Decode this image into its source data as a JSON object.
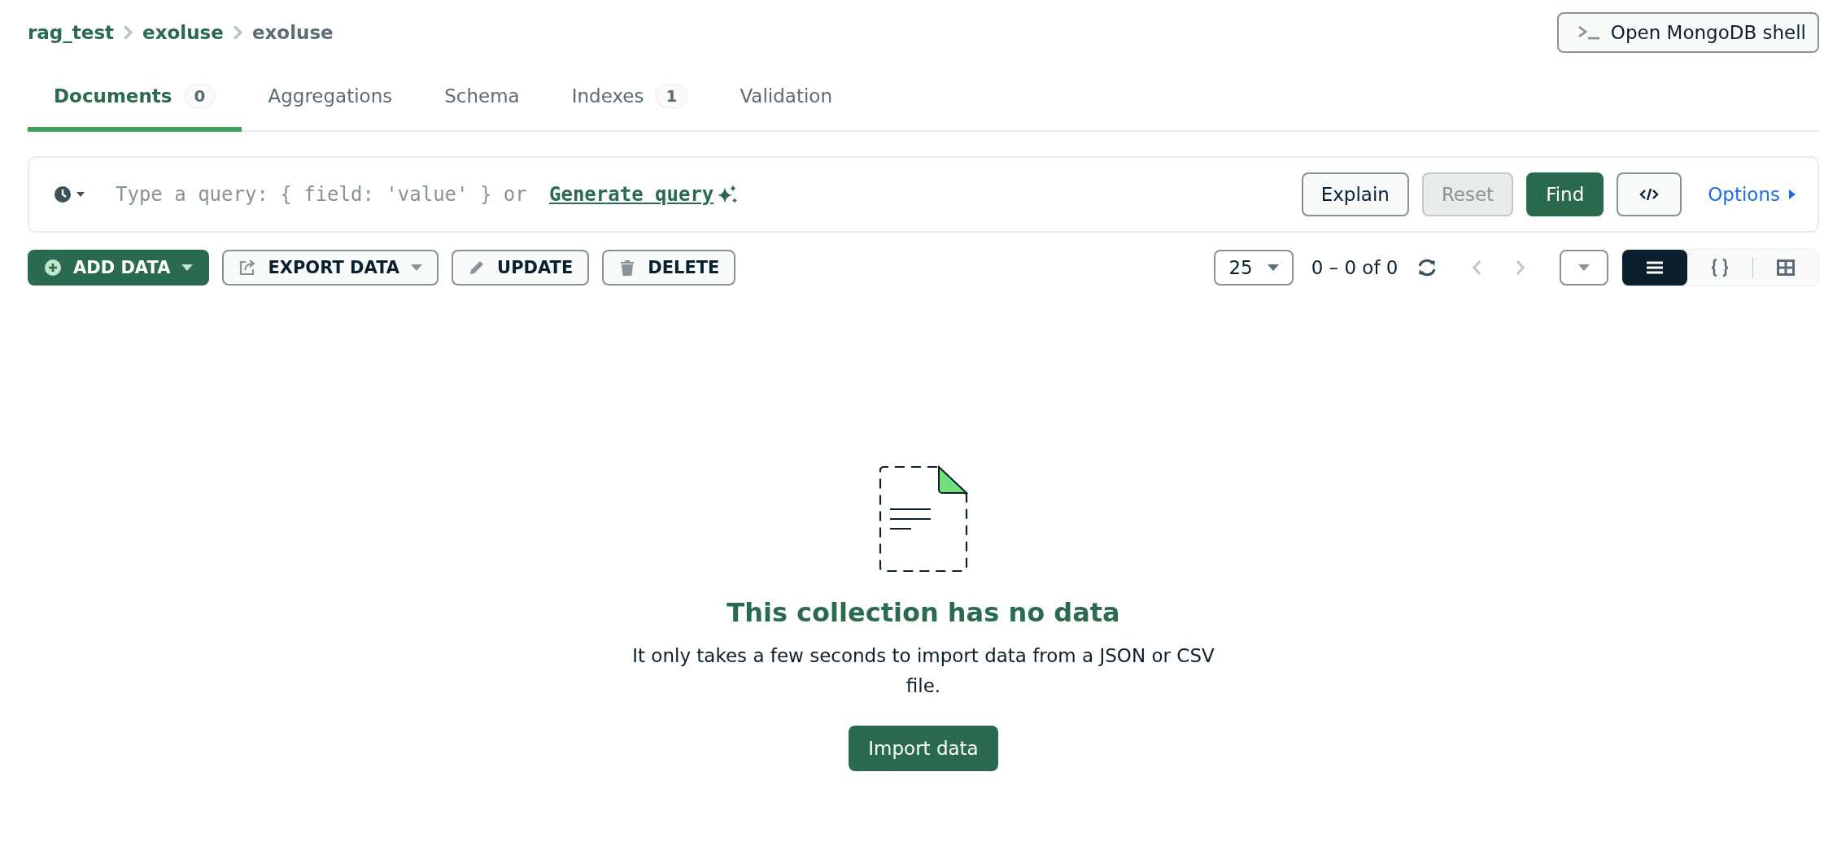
{
  "breadcrumb": [
    {
      "label": "rag_test",
      "kind": "link"
    },
    {
      "label": "exoluse",
      "kind": "link"
    },
    {
      "label": "exoluse",
      "kind": "current"
    }
  ],
  "shell_button": {
    "label": "Open MongoDB shell"
  },
  "tabs": [
    {
      "label": "Documents",
      "count": "0",
      "selected": true
    },
    {
      "label": "Aggregations",
      "selected": false
    },
    {
      "label": "Schema",
      "selected": false
    },
    {
      "label": "Indexes",
      "count": "1",
      "selected": false
    },
    {
      "label": "Validation",
      "selected": false
    }
  ],
  "query_bar": {
    "placeholder": "Type a query: { field: 'value' } or",
    "generate_link": "Generate query",
    "buttons": [
      {
        "label": "Explain",
        "kind": "outline",
        "disabled": false
      },
      {
        "label": "Reset",
        "kind": "outline",
        "disabled": true
      },
      {
        "label": "Find",
        "kind": "primary",
        "disabled": false
      },
      {
        "kind": "code",
        "disabled": false
      }
    ],
    "options_link": "Options"
  },
  "toolbar": {
    "actions": [
      {
        "label": "ADD DATA",
        "kind": "add",
        "dropdown": true
      },
      {
        "label": "EXPORT DATA",
        "kind": "export",
        "dropdown": true
      },
      {
        "label": "UPDATE",
        "kind": "update",
        "dropdown": false
      },
      {
        "label": "DELETE",
        "kind": "delete",
        "dropdown": false
      }
    ],
    "page_size": "25",
    "range": "0 – 0 of 0",
    "view_modes": [
      {
        "kind": "list",
        "selected": true
      },
      {
        "kind": "json",
        "selected": false
      },
      {
        "kind": "table",
        "selected": false
      }
    ]
  },
  "empty_state": {
    "title": "This collection has no data",
    "message": "It only takes a few seconds to import data from a JSON or CSV file.",
    "button": "Import data"
  }
}
